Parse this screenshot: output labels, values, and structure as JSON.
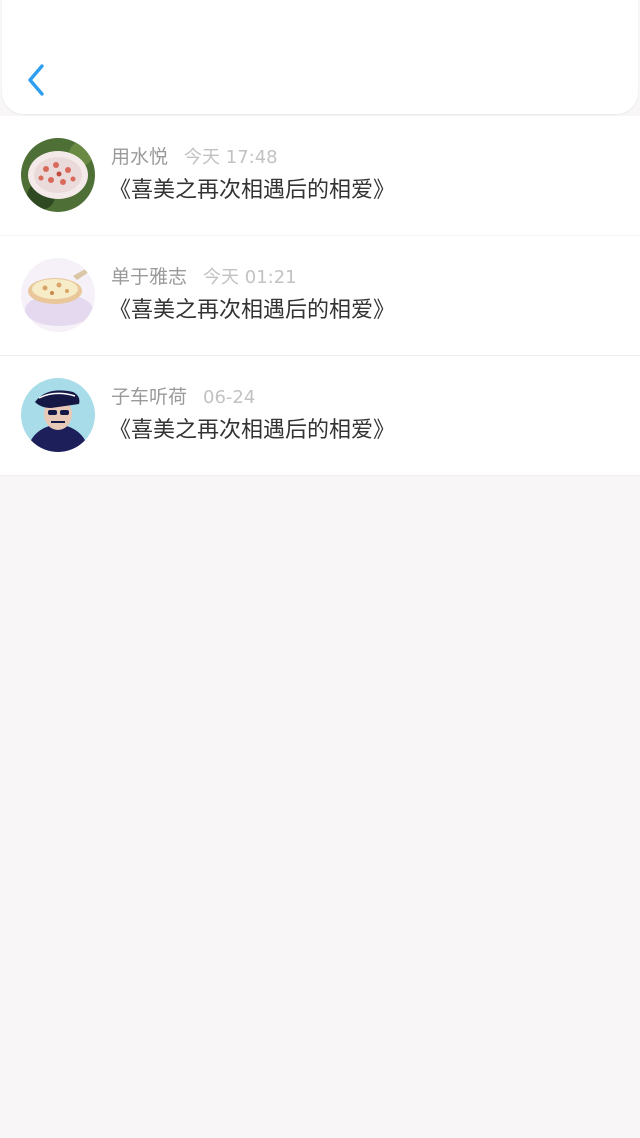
{
  "header": {
    "back_icon": "chevron-left-icon",
    "accent_color": "#2d9ef0"
  },
  "comments": [
    {
      "name": "用水悦",
      "time": "今天 17:48",
      "title": "《喜美之再次相遇后的相爱》",
      "avatar": "avatar-pizza-plate"
    },
    {
      "name": "单于雅志",
      "time": "今天 01:21",
      "title": "《喜美之再次相遇后的相爱》",
      "avatar": "avatar-pizza"
    },
    {
      "name": "子车听荷",
      "time": "06-24",
      "title": "《喜美之再次相遇后的相爱》",
      "avatar": "avatar-man-cap"
    }
  ]
}
